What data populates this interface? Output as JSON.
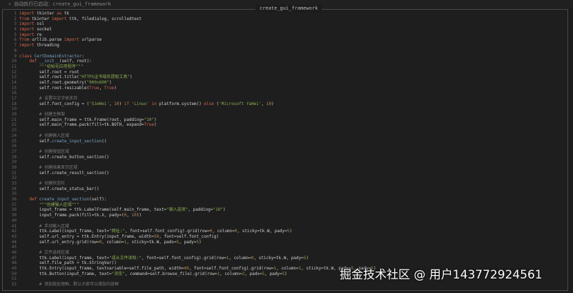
{
  "titlebar": {
    "icon": "bolt-icon",
    "text": "⚡ 自动执行已启动：create_gui_framework"
  },
  "frame_title": "create_gui_framework",
  "watermark": "掘金技术社区 @ 用户143772924561",
  "colors": {
    "keyword": "#d5684a",
    "string": "#8cae52",
    "comment": "#7b7b7b",
    "number": "#b88d4e",
    "function": "#79a6c8",
    "plain": "#cfcfcf",
    "lineno": "#6b6b6b"
  },
  "code_lines": [
    {
      "n": "1",
      "t": "import tkinter as tk"
    },
    {
      "n": "2",
      "t": "from tkinter import ttk, filedialog, scrolledtext"
    },
    {
      "n": "3",
      "t": "import ssl"
    },
    {
      "n": "4",
      "t": "import socket"
    },
    {
      "n": "5",
      "t": "import re"
    },
    {
      "n": "6",
      "t": "from urllib.parse import urlparse"
    },
    {
      "n": "7",
      "t": "import threading"
    },
    {
      "n": "8",
      "t": ""
    },
    {
      "n": "9",
      "t": "class CertDomainExtractor:"
    },
    {
      "n": "10",
      "t": "    def __init__(self, root):"
    },
    {
      "n": "11",
      "t": "        \"\"\"初始化应用程序\"\"\""
    },
    {
      "n": "12",
      "t": "        self.root = root"
    },
    {
      "n": "13",
      "t": "        self.root.title(\"HTTPS证书域名提取工具\")"
    },
    {
      "n": "14",
      "t": "        self.root.geometry(\"900x600\")"
    },
    {
      "n": "15",
      "t": "        self.root.resizable(True, True)"
    },
    {
      "n": "16",
      "t": ""
    },
    {
      "n": "17",
      "t": "        # 设置中文字体支持"
    },
    {
      "n": "18",
      "t": "        self.font_config = ('SimHei', 10) if 'Linux' in platform.system() else ('Microsoft YaHei', 10)"
    },
    {
      "n": "19",
      "t": ""
    },
    {
      "n": "20",
      "t": "        # 创建主框架"
    },
    {
      "n": "21",
      "t": "        self.main_frame = ttk.Frame(root, padding=\"10\")"
    },
    {
      "n": "22",
      "t": "        self.main_frame.pack(fill=tk.BOTH, expand=True)"
    },
    {
      "n": "23",
      "t": ""
    },
    {
      "n": "24",
      "t": "        # 创建输入区域"
    },
    {
      "n": "25",
      "t": "        self.create_input_section()"
    },
    {
      "n": "26",
      "t": ""
    },
    {
      "n": "27",
      "t": "        # 创建按钮区域"
    },
    {
      "n": "28",
      "t": "        self.create_button_section()"
    },
    {
      "n": "29",
      "t": ""
    },
    {
      "n": "30",
      "t": "        # 创建结果显示区域"
    },
    {
      "n": "31",
      "t": "        self.create_result_section()"
    },
    {
      "n": "32",
      "t": ""
    },
    {
      "n": "33",
      "t": "        # 创建状态栏"
    },
    {
      "n": "34",
      "t": "        self.create_status_bar()"
    },
    {
      "n": "35",
      "t": ""
    },
    {
      "n": "36",
      "t": "    def create_input_section(self):"
    },
    {
      "n": "37",
      "t": "        \"\"\"创建输入区域\"\"\""
    },
    {
      "n": "38",
      "t": "        input_frame = ttk.LabelFrame(self.main_frame, text=\"输入选项\", padding=\"10\")"
    },
    {
      "n": "39",
      "t": "        input_frame.pack(fill=tk.X, pady=(0, 10))"
    },
    {
      "n": "40",
      "t": ""
    },
    {
      "n": "41",
      "t": "        # 手动输入区域"
    },
    {
      "n": "42",
      "t": "        ttk.Label(input_frame, text=\"网址:\", font=self.font_config).grid(row=0, column=0, sticky=tk.W, pady=5)"
    },
    {
      "n": "43",
      "t": "        self.url_entry = ttk.Entry(input_frame, width=50, font=self.font_config)"
    },
    {
      "n": "44",
      "t": "        self.url_entry.grid(row=0, column=1, sticky=tk.W, padx=5, pady=5)"
    },
    {
      "n": "45",
      "t": ""
    },
    {
      "n": "46",
      "t": "        # 文件选择区域"
    },
    {
      "n": "47",
      "t": "        ttk.Label(input_frame, text=\"或从文件读取:\", font=self.font_config).grid(row=1, column=0, sticky=tk.W, pady=5)"
    },
    {
      "n": "48",
      "t": "        self.file_path = tk.StringVar()"
    },
    {
      "n": "49",
      "t": "        ttk.Entry(input_frame, textvariable=self.file_path, width=40, font=self.font_config).grid(row=1, column=1, sticky=tk.W, padx=5, pady=5)"
    },
    {
      "n": "50",
      "t": "        ttk.Button(input_frame, text=\"浏览\", command=self.browse_file).grid(row=1, column=2, padx=5, pady=5)"
    },
    {
      "n": "51",
      "t": ""
    },
    {
      "n": "52",
      "t": "        # 添加批处理框，默认大家可以增加内容框"
    }
  ]
}
